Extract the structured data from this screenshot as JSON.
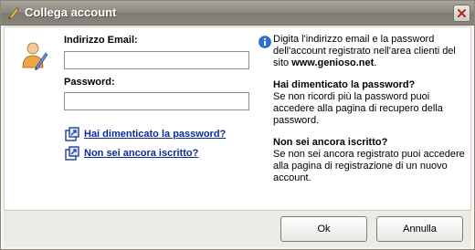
{
  "window": {
    "title": "Collega account"
  },
  "form": {
    "email_label": "Indirizzo Email:",
    "email_value": "",
    "password_label": "Password:",
    "password_value": ""
  },
  "links": {
    "forgot_password": "Hai dimenticato la password?",
    "not_registered": "Non sei ancora iscritto?"
  },
  "info": {
    "intro_prefix": "Digita l'indirizzo email e la password dell'account registrato nell'area clienti del sito ",
    "intro_site": "www.genioso.net",
    "intro_suffix": ".",
    "forgot_heading": "Hai dimenticato la password?",
    "forgot_body": "Se non ricordi più la password puoi accedere alla pagina di recupero della password.",
    "register_heading": "Non sei ancora iscritto?",
    "register_body": "Se non sei ancora registrato puoi accedere alla pagina di registrazione di un nuovo account."
  },
  "buttons": {
    "ok": "Ok",
    "cancel": "Annulla"
  },
  "colors": {
    "link": "#0a2b9c",
    "titlebar": "#8f8b82"
  },
  "icons": {
    "title": "quill-icon",
    "user": "user-edit-icon",
    "info": "info-icon",
    "link": "external-link-icon",
    "close": "close-icon"
  }
}
